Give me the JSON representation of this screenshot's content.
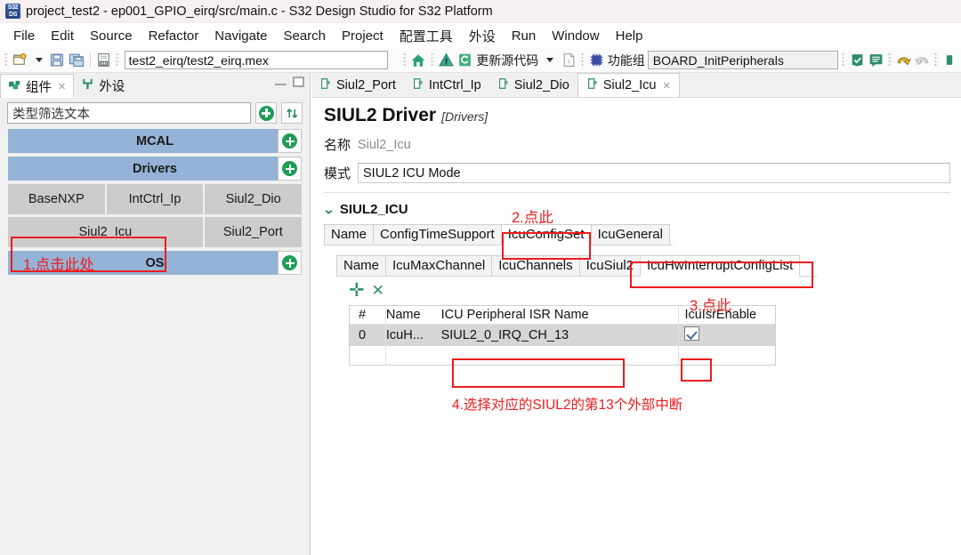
{
  "window": {
    "title": "project_test2 - ep001_GPIO_eirq/src/main.c - S32 Design Studio for S32 Platform",
    "app_icon": "s32ds-icon",
    "minimize_label": "",
    "maximize_label": ""
  },
  "menubar": {
    "items": [
      {
        "label": "File"
      },
      {
        "label": "Edit"
      },
      {
        "label": "Source"
      },
      {
        "label": "Refactor"
      },
      {
        "label": "Navigate"
      },
      {
        "label": "Search"
      },
      {
        "label": "Project"
      },
      {
        "label": "配置工具"
      },
      {
        "label": "外设"
      },
      {
        "label": "Run"
      },
      {
        "label": "Window"
      },
      {
        "label": "Help"
      }
    ]
  },
  "toolbar": {
    "new_icon": "new-file-icon",
    "dropdown_icon": "chevron-down-icon",
    "save_icon": "save-icon",
    "save_all_icon": "save-all-icon",
    "binary_icon": "binary-file-icon",
    "mex_path": "test2_eirq/test2_eirq.mex",
    "home_icon": "home-icon",
    "warning_icon": "warning-icon",
    "update_code_icon": "update-source-icon",
    "update_code_label": "更新源代码",
    "update_caret_icon": "chevron-down-icon",
    "doc_icon": "document-icon",
    "chip_icon": "chip-icon",
    "function_group_label": "功能组",
    "function_group_value": "BOARD_InitPeripherals",
    "validate_icon": "validate-icon",
    "problems_icon": "problems-icon",
    "undo_icon": "undo-icon",
    "redo_icon": "redo-icon"
  },
  "left_panel": {
    "tabs": [
      {
        "label": "组件",
        "icon": "components-icon",
        "active": true,
        "closeable": true
      },
      {
        "label": "外设",
        "icon": "peripherals-icon",
        "active": false,
        "closeable": false
      }
    ],
    "minimize_icon": "minimize-icon",
    "maximize_icon": "maximize-icon",
    "filter_placeholder": "类型筛选文本",
    "filter_value": "",
    "add_icon": "add-circle-icon",
    "sort_icon": "sort-icon",
    "groups": [
      {
        "name": "MCAL",
        "add_icon": "add-circle-icon",
        "components": []
      },
      {
        "name": "Drivers",
        "add_icon": "add-circle-icon",
        "components": [
          [
            "BaseNXP",
            "IntCtrl_Ip",
            "Siul2_Dio"
          ],
          [
            "Siul2_Icu",
            "Siul2_Port"
          ]
        ]
      },
      {
        "name": "OS",
        "add_icon": "add-circle-icon",
        "components": []
      }
    ]
  },
  "right_panel": {
    "tabs": [
      {
        "label": "Siul2_Port",
        "icon": "component-tab-icon",
        "active": false,
        "closeable": false
      },
      {
        "label": "IntCtrl_Ip",
        "icon": "component-tab-icon",
        "active": false,
        "closeable": false
      },
      {
        "label": "Siul2_Dio",
        "icon": "component-tab-icon",
        "active": false,
        "closeable": false
      },
      {
        "label": "Siul2_Icu",
        "icon": "component-tab-icon",
        "active": true,
        "closeable": true
      }
    ],
    "driver_title": "SIUL2 Driver",
    "driver_scope": "[Drivers]",
    "name_label": "名称",
    "name_value": "Siul2_Icu",
    "mode_label": "模式",
    "mode_value": "SIUL2 ICU Mode",
    "section_title": "SIUL2_ICU",
    "section_chevron": "chevron-down-icon",
    "level1_tabs": [
      {
        "label": "Name",
        "selected": false
      },
      {
        "label": "ConfigTimeSupport",
        "selected": false
      },
      {
        "label": "IcuConfigSet",
        "selected": true
      },
      {
        "label": "IcuGeneral",
        "selected": false
      }
    ],
    "level2_tabs": [
      {
        "label": "Name",
        "selected": false
      },
      {
        "label": "IcuMaxChannel",
        "selected": false
      },
      {
        "label": "IcuChannels",
        "selected": false
      },
      {
        "label": "IcuSiul2",
        "selected": false
      },
      {
        "label": "IcuHwInterruptConfigList",
        "selected": true
      }
    ],
    "add_row_icon": "plus-icon",
    "delete_row_icon": "delete-x-icon",
    "table": {
      "columns": [
        "#",
        "Name",
        "ICU Peripheral ISR Name",
        "IcuIsrEnable"
      ],
      "rows": [
        {
          "index": "0",
          "name": "IcuH...",
          "isr_name": "SIUL2_0_IRQ_CH_13",
          "isr_enable": true,
          "selected": true
        }
      ]
    }
  },
  "annotations": [
    {
      "id": "step1",
      "text": "1.点击此处",
      "color": "#ee1b1b"
    },
    {
      "id": "step2",
      "text": "2.点此",
      "color": "#ee1b1b"
    },
    {
      "id": "step3",
      "text": "3.点此",
      "color": "#ee1b1b"
    },
    {
      "id": "step4",
      "text": "4.选择对应的SIUL2的第13个外部中断",
      "color": "#ee1b1b"
    }
  ],
  "colors": {
    "group_header_blue": "#95b3d7",
    "component_gray": "#cccccc",
    "annotation_red": "#ee1b1b",
    "accent_green": "#1f9c56",
    "selected_row_gray": "#d6d6d6"
  }
}
